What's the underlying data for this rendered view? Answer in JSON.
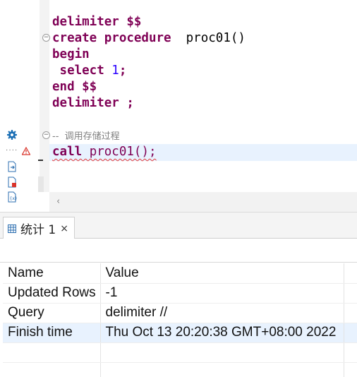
{
  "editor": {
    "lines": {
      "l1_kw": "delimiter",
      "l1_rest": " $$",
      "l2_kw": "create procedure",
      "l2_rest": "  proc01()",
      "l3_kw": "begin",
      "l4_kw": " select",
      "l4_num": " 1",
      "l4_rest": ";",
      "l5_kw": "end",
      "l5_rest": " $$",
      "l6_kw": "delimiter",
      "l6_rest": " ;",
      "l7_comment": "--  调用存储过程",
      "l8_kw": "call",
      "l8_rest": " proc01();"
    },
    "gutter_icons": [
      "gear-icon",
      "warning-icon",
      "export-icon",
      "file-error-icon",
      "file-script-icon"
    ],
    "scroll_arrow": "‹"
  },
  "results": {
    "tab_label": "统计 1",
    "tab_close": "×",
    "rows": [
      {
        "name": "Name",
        "value": "Value"
      },
      {
        "name": "Updated Rows",
        "value": "-1"
      },
      {
        "name": "Query",
        "value": "delimiter //"
      },
      {
        "name": "Finish time",
        "value": "Thu Oct 13 20:20:38 GMT+08:00 2022"
      }
    ],
    "selected_row": 3,
    "colors": {
      "selection": "#e8f2fe",
      "keyword": "#7f0055",
      "number": "#2a00ff"
    }
  }
}
